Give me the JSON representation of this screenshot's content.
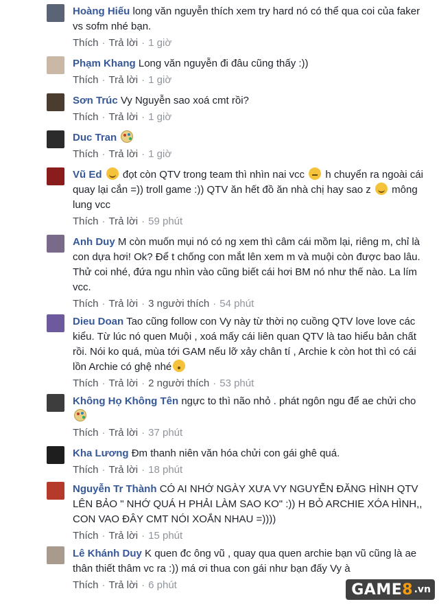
{
  "actions": {
    "like": "Thích",
    "reply": "Trả lời",
    "sep": "·"
  },
  "comments": [
    {
      "name": "Hoàng Hiếu",
      "parts": [
        "long văn nguyễn thích xem try hard nó có thể qua coi của faker vs sofm nhé bạn."
      ],
      "likes": "",
      "time": "1 giờ",
      "avatar_color": "#5b6475"
    },
    {
      "name": "Phạm Khang",
      "parts": [
        "Long văn nguyễn đi đâu cũng thấy :))"
      ],
      "likes": "",
      "time": "1 giờ",
      "avatar_color": "#c9b8a6"
    },
    {
      "name": "Sơn Trúc",
      "parts": [
        "Vy Nguyễn sao xoá cmt rồi?"
      ],
      "likes": "",
      "time": "1 giờ",
      "avatar_color": "#4a3c2e"
    },
    {
      "name": "Duc Tran",
      "parts": [
        ""
      ],
      "emoji_after_name": "palette-emoji",
      "likes": "",
      "time": "1 giờ",
      "avatar_color": "#2b2b2b"
    },
    {
      "name": "Vũ Ed",
      "parts": [
        "đọt còn QTV trong team thì nhìn nai vcc",
        "h chuyển ra ngoài cái quay lại cắn =)) troll game :)) QTV ăn hết đồ ăn nhà chị hay sao z",
        "mông lung vcc"
      ],
      "emoji_after_name": "smile-emoji",
      "likes": "",
      "time": "59 phút",
      "avatar_color": "#8a1c1c"
    },
    {
      "name": "Anh Duy",
      "parts": [
        "M còn muốn mụi nó có ng xem thì câm cái mồm lại, riêng m, chỉ là con dựa hơi! Ok? Để t chống con mắt lên xem m và muội còn được bao lâu. Thử coi nhé, đứa ngu nhìn vào cũng biết cái hơi BM nó như thế nào. La lím vcc."
      ],
      "likes": "3 người thích",
      "time": "54 phút",
      "avatar_color": "#7a6a8a"
    },
    {
      "name": "Dieu Doan",
      "parts": [
        "Tao cũng follow con Vy này từ thời nọ cuồng QTV love love các kiểu. Từ lúc nó quen Muội , xoá mấy cái liên quan QTV là tao hiểu bản chất rồi. Nói ko quá, mùa tới GAM nếu lỡ xảy chân tí , Archie k còn hot thì có cái lồn Archie có ghệ nhé"
      ],
      "likes": "2 người thích",
      "time": "53 phút",
      "avatar_color": "#6c5a9c"
    },
    {
      "name": "Không Họ Không Tên",
      "parts": [
        "ngực to thì não nhỏ . phát ngôn ngu để ae chửi cho"
      ],
      "likes": "",
      "time": "37 phút",
      "avatar_color": "#3d3d3d"
    },
    {
      "name": "Kha Lương",
      "parts": [
        "Đm thanh niên văn hóa chửi con gái ghê quá."
      ],
      "likes": "",
      "time": "18 phút",
      "avatar_color": "#1e1e1e"
    },
    {
      "name": "Nguyễn Tr Thành",
      "parts": [
        "CÓ AI NHỚ NGÀY XƯA VY NGUYỄN ĐĂNG HÌNH QTV LÊN BẢO \" NHỚ QUÁ H PHẢI LÀM SAO KO\" :)) H BỎ ARCHIE XÓA HÌNH,, CON VAO ĐÂY CMT NÓI XOẮN NHAU =))))"
      ],
      "likes": "",
      "time": "15 phút",
      "avatar_color": "#b63a2a"
    },
    {
      "name": "Lê Khánh Duy",
      "parts": [
        "K quen đc ông vũ , quay qua quen archie bạn vũ cũng là ae thân thiết thâm vc ra :)) má ơi thua con gái như bạn đấy Vy à"
      ],
      "likes": "",
      "time": "6 phút",
      "avatar_color": "#a89a8c"
    }
  ],
  "logo": {
    "main": "GAME",
    "num": "8",
    "tld": ".vn",
    "accent": "#f39c12"
  },
  "colors": {
    "name": "#365899",
    "meta": "#90949c",
    "text": "#1d2129"
  }
}
